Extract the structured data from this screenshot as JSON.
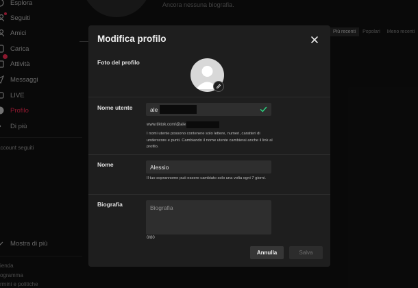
{
  "sidebar": {
    "items": [
      {
        "label": "Esplora",
        "icon": "compass-icon"
      },
      {
        "label": "Seguiti",
        "icon": "people-icon"
      },
      {
        "label": "Amici",
        "icon": "friends-icon"
      },
      {
        "label": "Carica",
        "icon": "upload-icon"
      },
      {
        "label": "Attività",
        "icon": "inbox-icon"
      },
      {
        "label": "Messaggi",
        "icon": "send-icon"
      },
      {
        "label": "LIVE",
        "icon": "live-icon"
      },
      {
        "label": "Profilo",
        "icon": "profile-icon"
      },
      {
        "label": "Di più",
        "icon": "more-icon"
      }
    ],
    "following_accounts": "account seguiti",
    "show_more": "Mostra di più",
    "footer_links": [
      "ienda",
      "ogramma",
      "rmini e politiche"
    ]
  },
  "profile": {
    "bio_placeholder": "Ancora nessuna biografia.",
    "tabs": [
      "Più recenti",
      "Popolari",
      "Meno recenti"
    ]
  },
  "modal": {
    "title": "Modifica profilo",
    "photo_label": "Foto del profilo",
    "username_label": "Nome utente",
    "username_value": "ale",
    "url_prefix": "www.tiktok.com/@ale",
    "username_help": "I nomi utente possono contenere solo lettere, numeri, caratteri di underscore e punti. Cambiando il nome utente cambierai anche il link al profilo.",
    "name_label": "Nome",
    "name_value": "Alessio",
    "name_help": "Il tuo soprannome può essere cambiato solo una volta ogni 7 giorni.",
    "bio_label": "Biografia",
    "bio_placeholder": "Biografia",
    "bio_counter": "0/80",
    "cancel_label": "Annulla",
    "save_label": "Salva"
  },
  "colors": {
    "accent": "#fe2c55",
    "valid_check": "#2bd17e",
    "modal_bg": "#1e1e1e"
  }
}
